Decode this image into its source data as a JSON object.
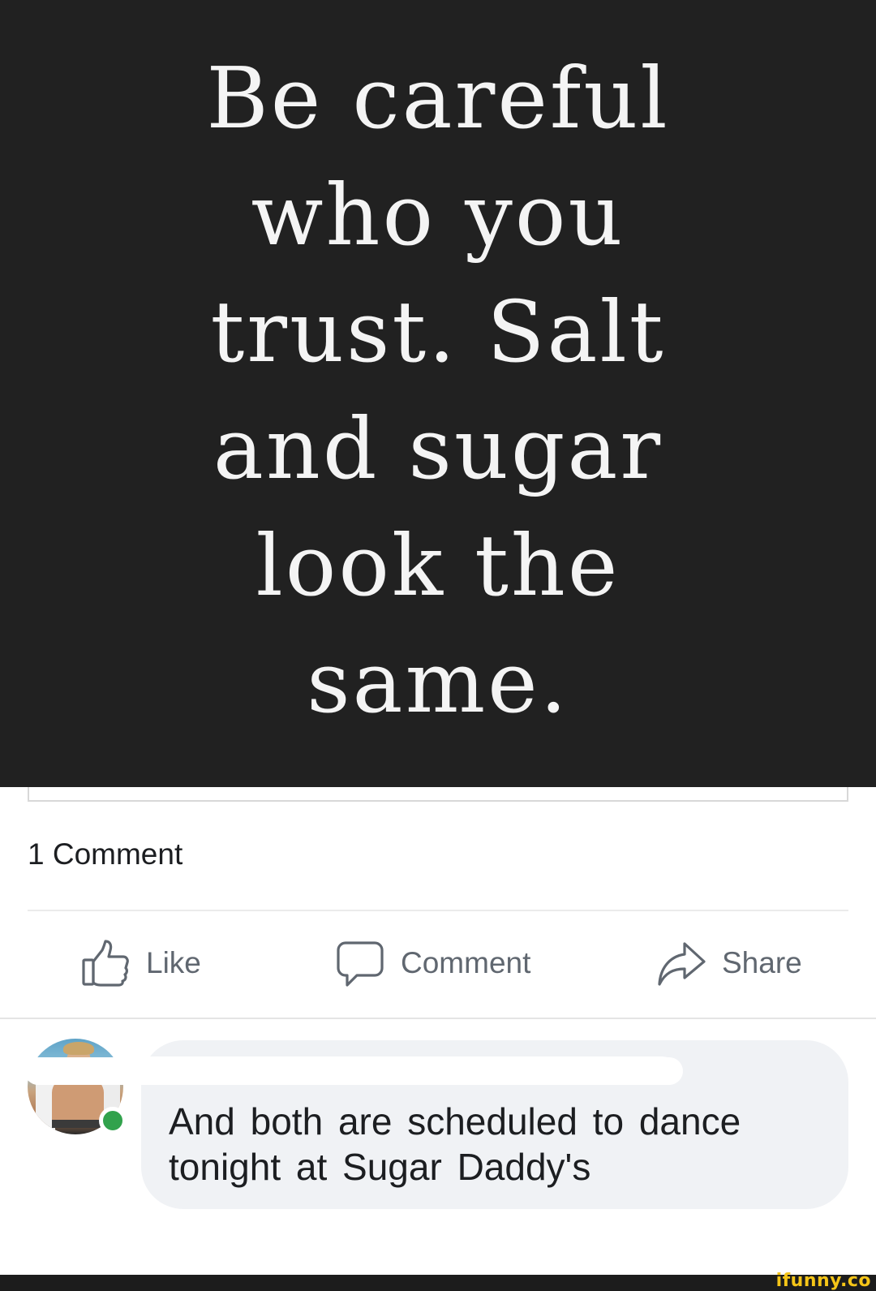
{
  "post": {
    "quote_lines": [
      "Be careful",
      "who you",
      "trust. Salt",
      "and sugar",
      "look the",
      "same."
    ]
  },
  "stats": {
    "comment_count": "1 Comment"
  },
  "actions": {
    "like": {
      "label": "Like",
      "icon": "thumbs-up-icon"
    },
    "comment": {
      "label": "Comment",
      "icon": "speech-bubble-icon"
    },
    "share": {
      "label": "Share",
      "icon": "share-arrow-icon"
    }
  },
  "comment": {
    "author_name": "",
    "text": "And both are scheduled to dance tonight at Sugar Daddy's",
    "online": true
  },
  "colors": {
    "post_background": "#212121",
    "action_gray": "#606770",
    "bubble_background": "#f0f2f5",
    "online_green": "#31a24c",
    "watermark_yellow": "#f5c518"
  },
  "watermark": "ifunny.co"
}
